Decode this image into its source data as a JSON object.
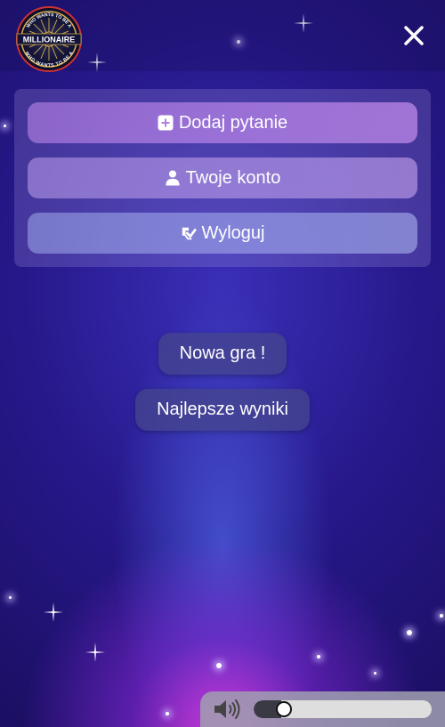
{
  "header": {
    "logo_arc_top": "WHO WANTS TO BE A",
    "logo_title": "MILLIONAIRE",
    "logo_arc_bottom": "WHO WANTS TO BE A",
    "close_icon": "close-icon"
  },
  "menu": {
    "items": [
      {
        "label": "Dodaj pytanie",
        "icon": "plus-square-icon"
      },
      {
        "label": "Twoje konto",
        "icon": "user-icon"
      },
      {
        "label": "Wyloguj",
        "icon": "logout-icon"
      }
    ]
  },
  "main": {
    "new_game_label": "Nowa gra !",
    "high_scores_label": "Najlepsze wyniki"
  },
  "sound": {
    "icon": "speaker-icon",
    "volume": 0.1
  },
  "colors": {
    "background_dark": "#1b0f63",
    "background_glow": "#e63ce6",
    "button_bg": "#46468c"
  }
}
